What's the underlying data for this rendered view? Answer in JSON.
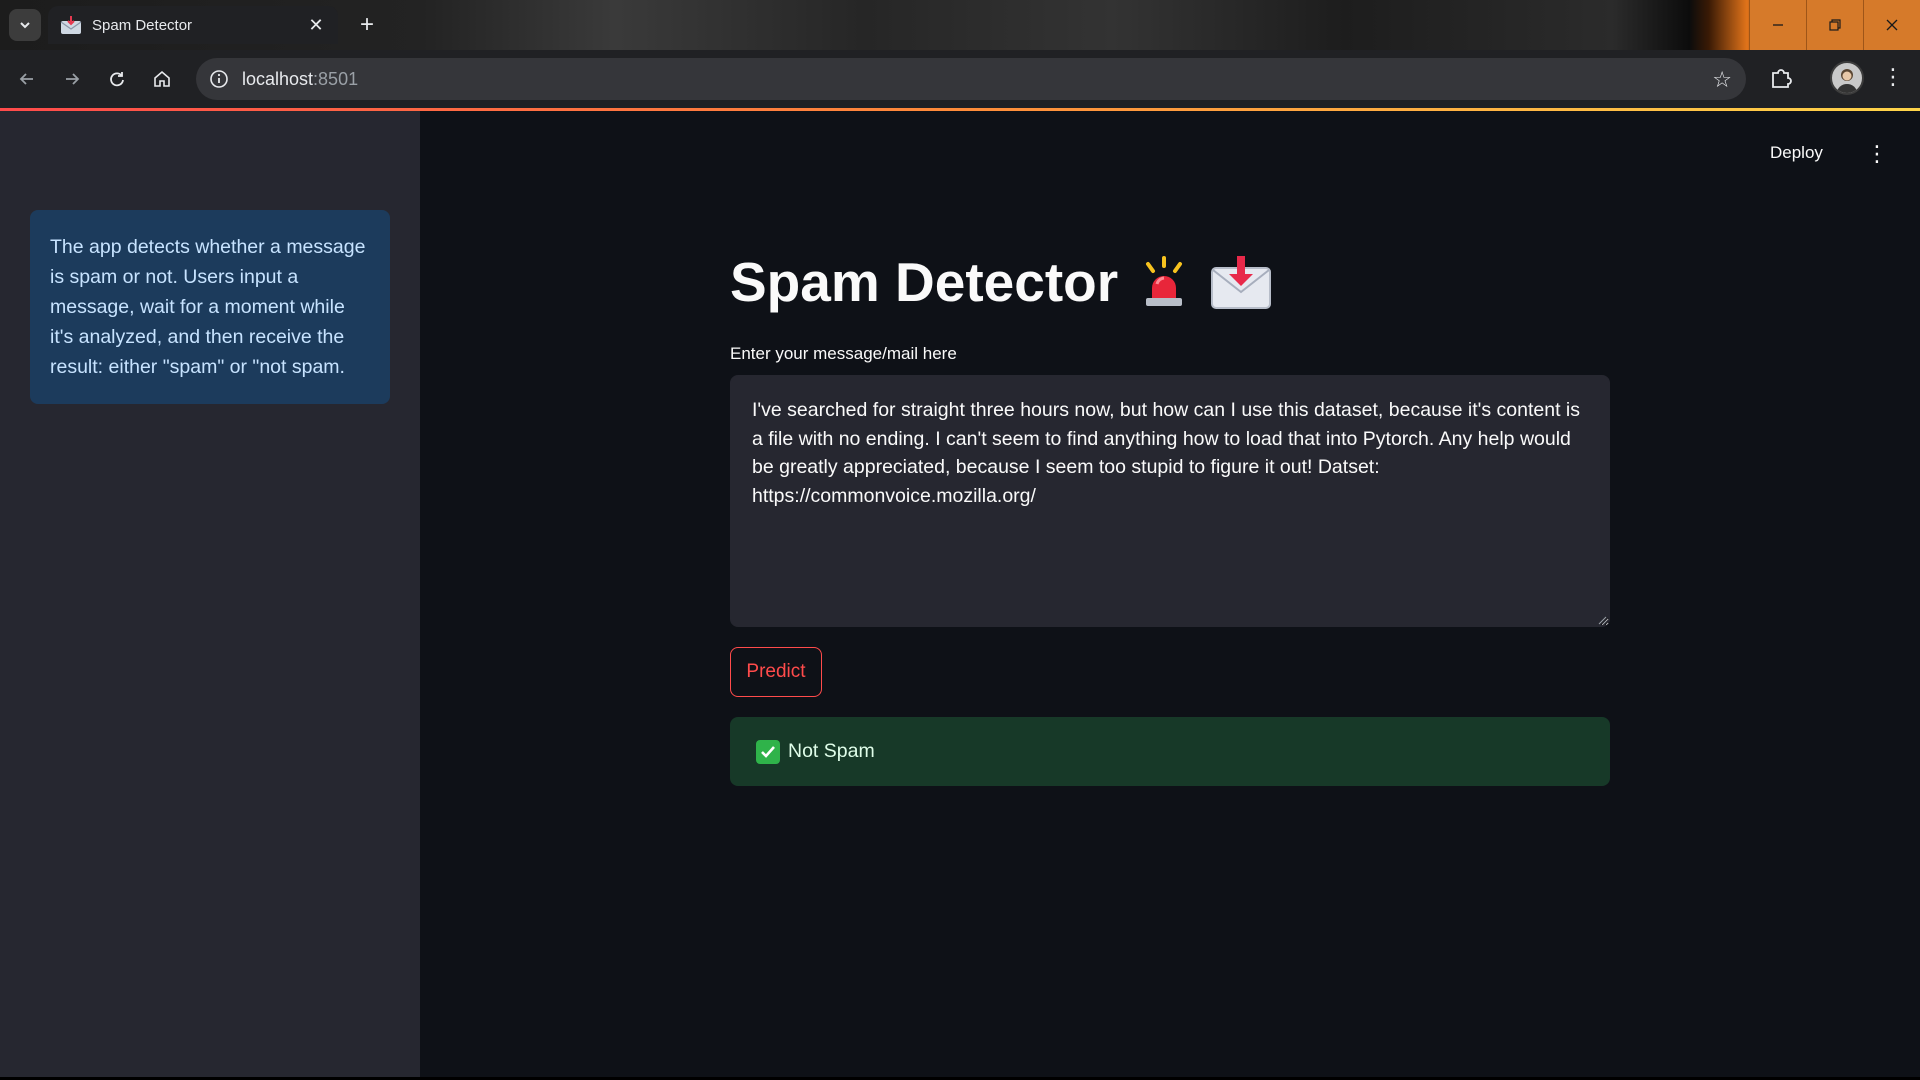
{
  "browser": {
    "tab_title": "Spam Detector",
    "tab_close": "✕",
    "new_tab": "+",
    "url_host": "localhost",
    "url_port": ":8501",
    "accent_color": "#ff4b4b"
  },
  "header": {
    "deploy_label": "Deploy",
    "menu_icon": "⋮"
  },
  "sidebar": {
    "info_text": "The app detects whether a message is spam or not. Users input a message, wait for a moment while it's analyzed, and then receive the result: either \"spam\" or \"not spam."
  },
  "main": {
    "title": "Spam Detector",
    "input_label": "Enter your message/mail here",
    "message_value": "I've searched for straight three hours now, but how can I use this dataset, because it's content is a file with no ending. I can't seem to find anything how to load that into Pytorch. Any help would be greatly appreciated, because I seem too stupid to figure it out! Datset: https://commonvoice.mozilla.org/",
    "predict_label": "Predict",
    "result_text": "Not Spam"
  },
  "colors": {
    "info_bg": "#1c3b5c",
    "success_bg": "#173928",
    "success_icon": "#2fb34a"
  }
}
